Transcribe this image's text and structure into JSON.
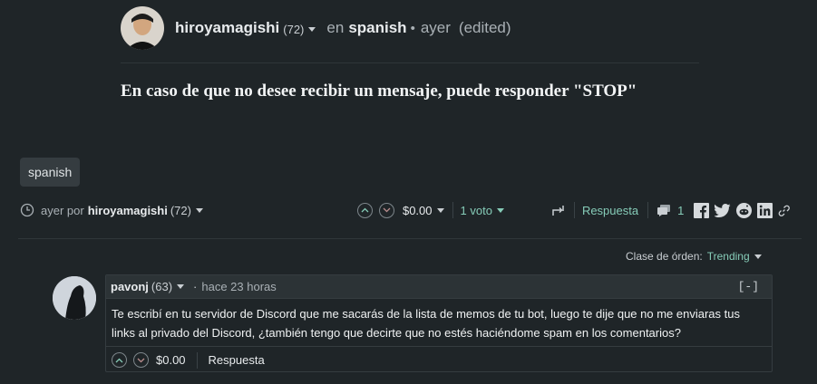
{
  "post": {
    "author": "hiroyamagishi",
    "author_rep": "(72)",
    "in_label": "en",
    "community": "spanish",
    "bullet": "•",
    "time": "ayer",
    "edited": "(edited)",
    "body": "En caso de que no desee recibir un mensaje, puede responder \"STOP\"",
    "tag": "spanish"
  },
  "footer": {
    "time_by": "ayer por",
    "author": "hiroyamagishi",
    "author_rep": "(72)",
    "payout": "$0.00",
    "votes": "1 voto",
    "reply": "Respuesta",
    "comments_count": "1"
  },
  "sort": {
    "label": "Clase de órden:",
    "value": "Trending"
  },
  "comment": {
    "author": "pavonj",
    "author_rep": "(63)",
    "bullet": "·",
    "time": "hace 23 horas",
    "collapse": "[-]",
    "text_line1": "Te escribí en tu servidor de Discord que me sacarás de la lista de memos de tu bot, luego te dije que no me enviaras tus",
    "text_line2": "links al privado del Discord, ¿también tengo que decirte que no estés haciéndome spam en los comentarios?",
    "payout": "$0.00",
    "reply": "Respuesta"
  },
  "colors": {
    "background": "#1f2528",
    "accent": "#86ccb8",
    "text": "#c9ced2"
  },
  "icons": [
    "clock-icon",
    "upvote-icon",
    "downvote-icon",
    "resteem-icon",
    "comments-icon",
    "facebook-icon",
    "twitter-icon",
    "reddit-icon",
    "linkedin-icon",
    "permalink-icon"
  ]
}
